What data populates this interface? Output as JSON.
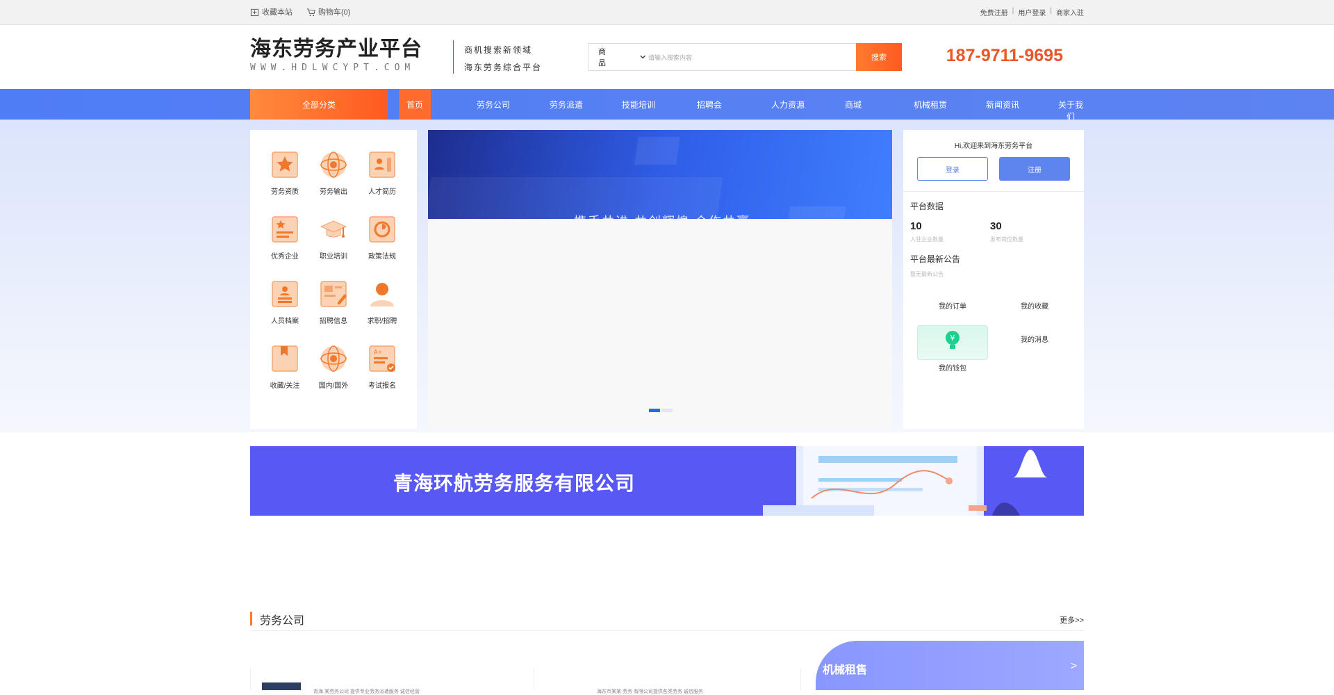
{
  "topbar": {
    "collect_label": "收藏本站",
    "cart_label": "购物车(0)",
    "links": [
      "免费注册",
      "用户登录",
      "商家入驻"
    ]
  },
  "header": {
    "logo_title": "海东劳务产业平台",
    "logo_url": "WWW.HDLWCYPT.COM",
    "slogan_line1": "商机搜索新领域",
    "slogan_line2": "海东劳务综合平台",
    "search_category": "商 品",
    "search_placeholder": "请输入搜索内容",
    "search_button": "搜索",
    "phone": "187-9711-9695"
  },
  "nav": {
    "all_label": "全部分类",
    "active_label": "首页",
    "items": [
      "劳务公司",
      "劳务派遣",
      "技能培训",
      "招聘会",
      "人力资源",
      "商城",
      "机械租赁",
      "新闻资讯",
      "关于我们"
    ]
  },
  "categories": [
    {
      "label": "劳务资质",
      "icon": "star-certificate-icon"
    },
    {
      "label": "劳务输出",
      "icon": "globe-icon"
    },
    {
      "label": "人才简历",
      "icon": "resume-icon"
    },
    {
      "label": "优秀企业",
      "icon": "award-doc-icon"
    },
    {
      "label": "职业培训",
      "icon": "graduation-cap-icon"
    },
    {
      "label": "政策法规",
      "icon": "policy-icon"
    },
    {
      "label": "人员档案",
      "icon": "person-doc-icon"
    },
    {
      "label": "招聘信息",
      "icon": "edit-doc-icon"
    },
    {
      "label": "求职/招聘",
      "icon": "person-icon"
    },
    {
      "label": "收藏/关注",
      "icon": "bookmark-icon"
    },
    {
      "label": "国内/国外",
      "icon": "globe-icon"
    },
    {
      "label": "考试报名",
      "icon": "check-doc-icon"
    }
  ],
  "banner": {
    "caption": "携手共进 共创辉煌 合作共赢",
    "slide_count": 2
  },
  "user": {
    "greeting": "Hi,欢迎来到海东劳务平台",
    "login_label": "登录",
    "register_label": "注册",
    "stats_title": "平台数据",
    "stats": [
      {
        "num": "10",
        "label": "入驻企业数量"
      },
      {
        "num": "30",
        "label": "发布岗位数量"
      }
    ],
    "notice_title": "平台最新公告",
    "notice_sub": "暂无最新公告",
    "services": [
      "我的订单",
      "我的收藏",
      "我的钱包",
      "我的消息"
    ]
  },
  "ad": {
    "text": "青海环航劳务服务有限公司"
  },
  "section": {
    "title": "劳务公司",
    "more": "更多>>",
    "card_texts": [
      "青海 某劳务公司 提供专业劳务派遣服务 诚信经营",
      "海东市某某 劳务 有限公司提供各类劳务 诚信服务"
    ],
    "rent_title": "机械租售",
    "rent_arrow": ">"
  },
  "colors": {
    "nav": "#4f7df4",
    "accent": "#ff6b2c",
    "phone": "#e8562a",
    "ad": "#5858f5"
  }
}
